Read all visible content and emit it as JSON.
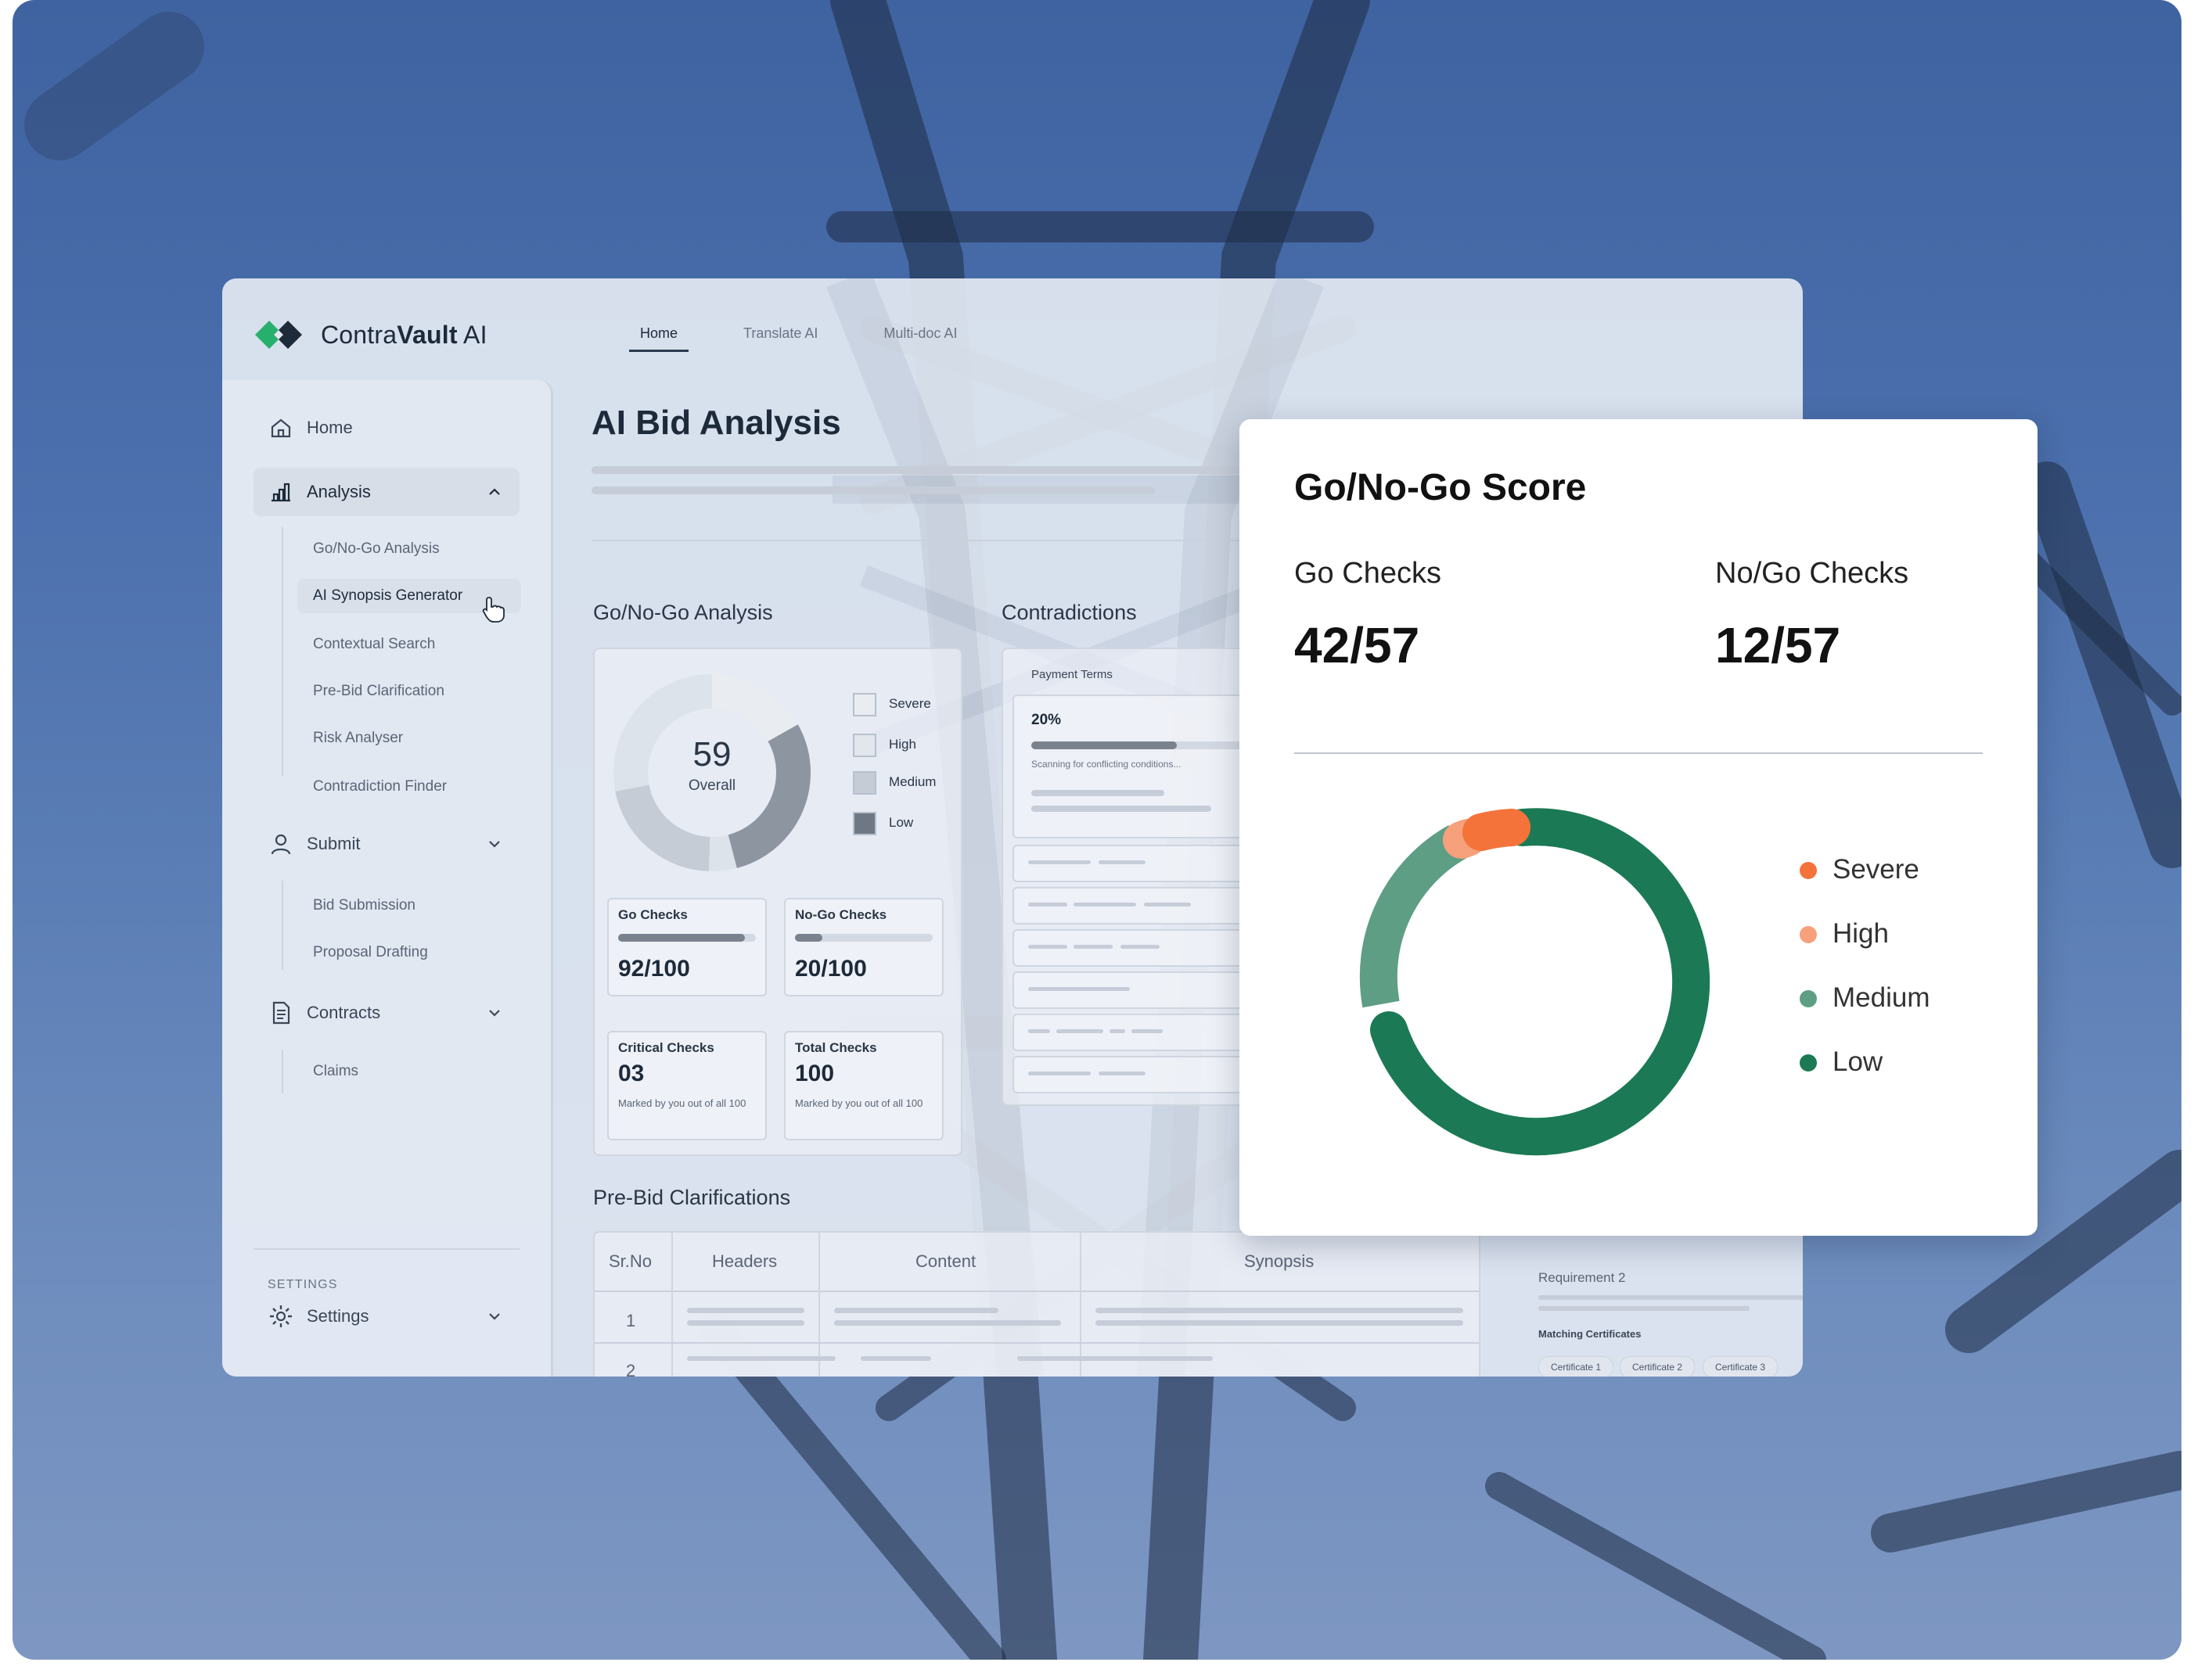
{
  "app": {
    "logo_text": "ContraVault AI",
    "logo_word1": "Contra",
    "logo_word2": "Vault",
    "logo_word3": " AI",
    "top_tabs": [
      "Home",
      "Translate AI",
      "Multi-doc AI"
    ],
    "active_tab": "Home"
  },
  "sidebar": {
    "home": "Home",
    "analysis": "Analysis",
    "analysis_items": [
      "Go/No-Go Analysis",
      "AI Synopsis Generator",
      "Contextual Search",
      "Pre-Bid Clarification",
      "Risk Analyser",
      "Contradiction Finder"
    ],
    "submit": "Submit",
    "submit_items": [
      "Bid Submission",
      "Proposal Drafting"
    ],
    "contracts": "Contracts",
    "contracts_items": [
      "Claims"
    ],
    "settings_header": "SETTINGS",
    "settings": "Settings"
  },
  "main": {
    "title": "AI Bid Analysis",
    "go_nogo_title": "Go/No-Go Analysis",
    "gauge_value": "59",
    "gauge_label": "Overall",
    "legend": [
      "Severe",
      "High",
      "Medium",
      "Low"
    ],
    "go_checks": {
      "label": "Go Checks",
      "value": "92/100",
      "fill": 0.92
    },
    "nogo_checks": {
      "label": "No-Go Checks",
      "value": "20/100",
      "fill": 0.2
    },
    "critical_checks": {
      "label": "Critical Checks",
      "value": "03",
      "note": "Marked by you out of all 100"
    },
    "total_checks": {
      "label": "Total Checks",
      "value": "100",
      "note": "Marked by you out of all 100"
    },
    "contradictions_title": "Contradictions",
    "payment_terms": "Payment Terms",
    "progress_pct": "20%",
    "progress_fill": 0.2,
    "scanning_text": "Scanning for conflicting conditions...",
    "prebid_title": "Pre-Bid Clarifications",
    "table_headers": [
      "Sr.No",
      "Headers",
      "Content",
      "Synopsis"
    ],
    "table_rows": [
      "1",
      "2"
    ],
    "requirement": "Requirement 2",
    "matching_certificates": "Matching Certificates",
    "certificates": [
      "Certificate 1",
      "Certificate 2",
      "Certificate 3"
    ]
  },
  "score_card": {
    "title": "Go/No-Go Score",
    "go_label": "Go Checks",
    "go_value": "42/57",
    "nogo_label": "No/Go Checks",
    "nogo_value": "12/57",
    "legend": [
      {
        "label": "Severe",
        "color": "#f4733a"
      },
      {
        "label": "High",
        "color": "#f6a07c"
      },
      {
        "label": "Medium",
        "color": "#5e9e84"
      },
      {
        "label": "Low",
        "color": "#1b7a55"
      }
    ]
  },
  "colors": {
    "severe": "#f4733a",
    "high": "#f6a07c",
    "medium": "#5e9e84",
    "low": "#1b7a55",
    "logo_green": "#27b06c",
    "logo_dark": "#1d2a3a"
  }
}
